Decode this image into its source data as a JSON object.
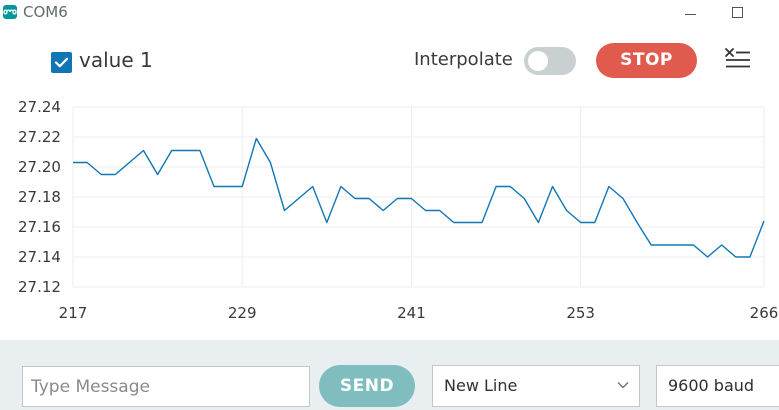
{
  "window": {
    "title": "COM6",
    "icon": "arduino-infinity-icon",
    "controls": [
      "minimize-icon",
      "maximize-icon"
    ]
  },
  "toolbar": {
    "series_label": "value 1",
    "series_checked": true,
    "interpolate_label": "Interpolate",
    "interpolate_on": false,
    "stop_label": "STOP",
    "clear_icon": "clear-plot-icon"
  },
  "colors": {
    "accent": "#1176b5",
    "stop": "#e05a4d",
    "send": "#7fbdbe",
    "line": "#1176b5",
    "bottom_bar": "#e9eef0"
  },
  "chart_data": {
    "type": "line",
    "ylim": [
      27.12,
      27.24
    ],
    "y_ticks": [
      "27.24",
      "27.22",
      "27.20",
      "27.18",
      "27.16",
      "27.14",
      "27.12"
    ],
    "xlim": [
      217,
      266
    ],
    "x_ticks": [
      "217",
      "229",
      "241",
      "253",
      "266"
    ],
    "grid": true,
    "series": [
      {
        "x": [
          217,
          218,
          219,
          220,
          221,
          222,
          223,
          224,
          225,
          226,
          227,
          228,
          229,
          230,
          231,
          232,
          233,
          234,
          235,
          236,
          237,
          238,
          239,
          240,
          241,
          242,
          243,
          244,
          245,
          246,
          247,
          248,
          249,
          250,
          251,
          252,
          253,
          254,
          255,
          256,
          257,
          258,
          259,
          260,
          261,
          262,
          263,
          264,
          265,
          266
        ],
        "values": [
          27.203,
          27.203,
          27.195,
          27.195,
          27.203,
          27.211,
          27.195,
          27.211,
          27.211,
          27.211,
          27.187,
          27.187,
          27.187,
          27.219,
          27.203,
          27.171,
          27.179,
          27.187,
          27.163,
          27.187,
          27.179,
          27.179,
          27.171,
          27.179,
          27.179,
          27.171,
          27.171,
          27.163,
          27.163,
          27.163,
          27.187,
          27.187,
          27.179,
          27.163,
          27.187,
          27.171,
          27.163,
          27.163,
          27.187,
          27.179,
          27.163,
          27.148,
          27.148,
          27.148,
          27.148,
          27.14,
          27.148,
          27.14,
          27.14,
          27.164
        ]
      }
    ]
  },
  "footer": {
    "message_placeholder": "Type Message",
    "message_value": "",
    "send_label": "SEND",
    "line_ending": "New Line",
    "baud_rate": "9600 baud"
  }
}
